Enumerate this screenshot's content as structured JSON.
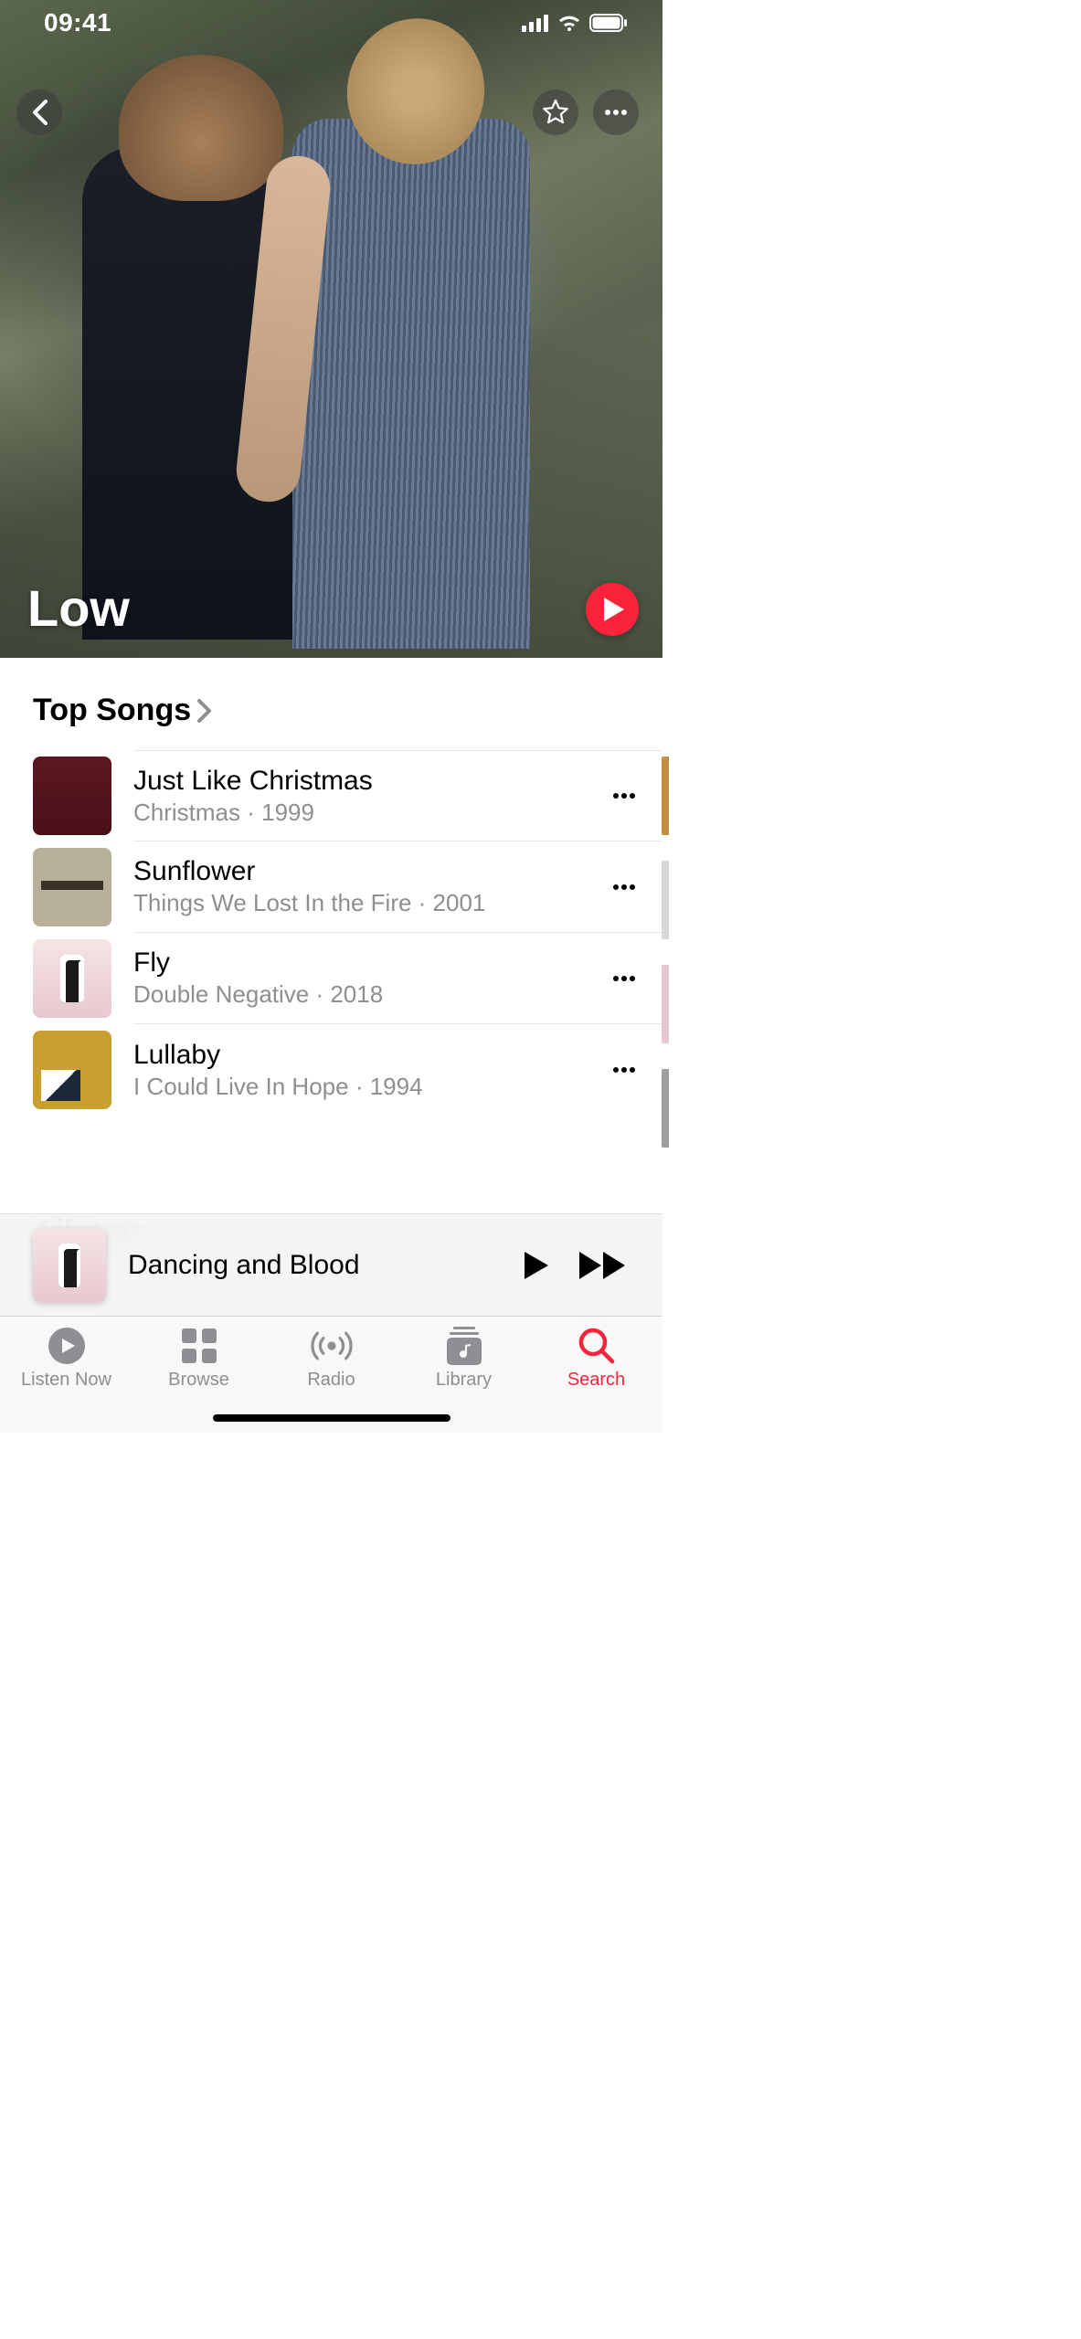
{
  "status": {
    "time": "09:41"
  },
  "artist": {
    "name": "Low"
  },
  "sections": {
    "top_songs": {
      "title": "Top Songs",
      "songs": [
        {
          "title": "Just Like Christmas",
          "album": "Christmas",
          "year": "1999"
        },
        {
          "title": "Sunflower",
          "album": "Things We Lost In the Fire",
          "year": "2001"
        },
        {
          "title": "Fly",
          "album": "Double Negative",
          "year": "2018"
        },
        {
          "title": "Lullaby",
          "album": "I Could Live In Hope",
          "year": "1994"
        }
      ]
    },
    "albums": {
      "title": "Albums"
    }
  },
  "now_playing": {
    "title": "Dancing and Blood"
  },
  "tabs": {
    "listen_now": "Listen Now",
    "browse": "Browse",
    "radio": "Radio",
    "library": "Library",
    "search": "Search",
    "active": "search"
  },
  "colors": {
    "accent": "#fa233b",
    "art_peek": [
      "#c49040",
      "#d8d8d8",
      "#e8c8d0",
      "#9e9e9e"
    ]
  }
}
